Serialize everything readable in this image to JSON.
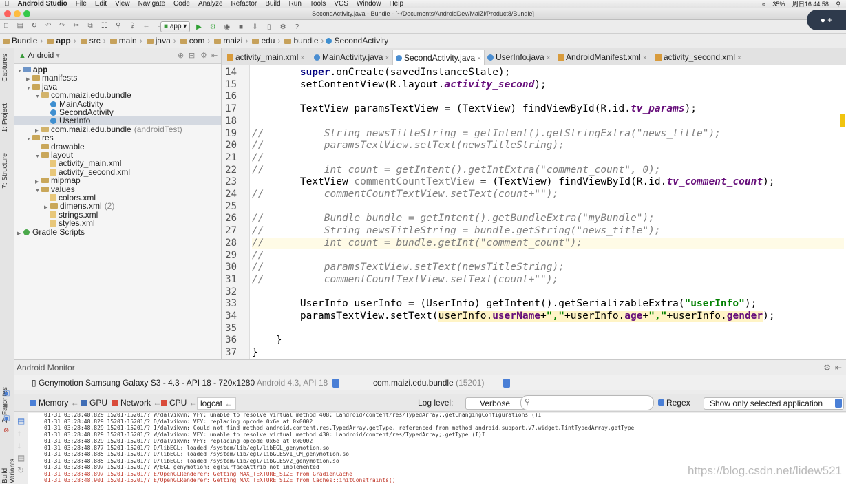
{
  "menubar": {
    "app": "Android Studio",
    "items": [
      "File",
      "Edit",
      "View",
      "Navigate",
      "Code",
      "Analyze",
      "Refactor",
      "Build",
      "Run",
      "Tools",
      "VCS",
      "Window",
      "Help"
    ],
    "battery": "35%",
    "clock": "周日16:44:58"
  },
  "window": {
    "title": "SecondActivity.java - Bundle - [~/Documents/AndroidDev/MaiZi/Product8/Bundle]"
  },
  "toolbar": {
    "run_config": "app"
  },
  "breadcrumb": [
    "Bundle",
    "app",
    "src",
    "main",
    "java",
    "com",
    "maizi",
    "edu",
    "bundle",
    "SecondActivity"
  ],
  "side_tabs": {
    "captures": "Captures",
    "project": "1: Project",
    "structure": "7: Structure",
    "favorites": "2: Favorites",
    "variants": "Build Variants"
  },
  "project": {
    "view": "Android",
    "tree": [
      {
        "label": "app",
        "indent": 0,
        "icon": "folder-blue",
        "open": true,
        "bold": true
      },
      {
        "label": "manifests",
        "indent": 1,
        "icon": "folder",
        "open": false
      },
      {
        "label": "java",
        "indent": 1,
        "icon": "folder",
        "open": true
      },
      {
        "label": "com.maizi.edu.bundle",
        "indent": 2,
        "icon": "package",
        "open": true
      },
      {
        "label": "MainActivity",
        "indent": 3,
        "icon": "class"
      },
      {
        "label": "SecondActivity",
        "indent": 3,
        "icon": "class"
      },
      {
        "label": "UserInfo",
        "indent": 3,
        "icon": "class",
        "selected": true
      },
      {
        "label": "com.maizi.edu.bundle",
        "suffix": "(androidTest)",
        "indent": 2,
        "icon": "package",
        "open": false
      },
      {
        "label": "res",
        "indent": 1,
        "icon": "folder",
        "open": true
      },
      {
        "label": "drawable",
        "indent": 2,
        "icon": "folder"
      },
      {
        "label": "layout",
        "indent": 2,
        "icon": "folder",
        "open": true
      },
      {
        "label": "activity_main.xml",
        "indent": 3,
        "icon": "xml"
      },
      {
        "label": "activity_second.xml",
        "indent": 3,
        "icon": "xml"
      },
      {
        "label": "mipmap",
        "indent": 2,
        "icon": "folder",
        "open": false
      },
      {
        "label": "values",
        "indent": 2,
        "icon": "folder",
        "open": true
      },
      {
        "label": "colors.xml",
        "indent": 3,
        "icon": "xml"
      },
      {
        "label": "dimens.xml",
        "suffix": "(2)",
        "indent": 3,
        "icon": "folder",
        "open": false
      },
      {
        "label": "strings.xml",
        "indent": 3,
        "icon": "xml"
      },
      {
        "label": "styles.xml",
        "indent": 3,
        "icon": "xml"
      },
      {
        "label": "Gradle Scripts",
        "indent": 0,
        "icon": "gradle",
        "open": false
      }
    ]
  },
  "tabs": [
    {
      "label": "activity_main.xml",
      "type": "xml",
      "active": false
    },
    {
      "label": "MainActivity.java",
      "type": "java",
      "active": false
    },
    {
      "label": "SecondActivity.java",
      "type": "java",
      "active": true
    },
    {
      "label": "UserInfo.java",
      "type": "java",
      "active": false
    },
    {
      "label": "AndroidManifest.xml",
      "type": "xml",
      "active": false
    },
    {
      "label": "activity_second.xml",
      "type": "xml",
      "active": false
    }
  ],
  "code": [
    {
      "n": "14",
      "html": "        <span class=\"kw\">super</span>.onCreate(savedInstanceState);"
    },
    {
      "n": "15",
      "html": "        setContentView(R.layout.<span class=\"fld\">activity_second</span>);"
    },
    {
      "n": "16",
      "html": ""
    },
    {
      "n": "17",
      "html": "        TextView paramsTextView = (TextView) findViewById(R.id.<span class=\"fld\">tv_params</span>);"
    },
    {
      "n": "18",
      "html": ""
    },
    {
      "n": "19",
      "html": "<span class=\"cmt\">//          String newsTitleString = getIntent().getStringExtra(\"news_title\");</span>"
    },
    {
      "n": "20",
      "html": "<span class=\"cmt\">//          paramsTextView.setText(newsTitleString);</span>"
    },
    {
      "n": "21",
      "html": "<span class=\"cmt\">//</span>"
    },
    {
      "n": "22",
      "html": "<span class=\"cmt\">//          int count = getIntent().getIntExtra(\"comment_count\", 0);</span>"
    },
    {
      "n": "23",
      "html": "        TextView <span class=\"cmt\" style=\"font-style:normal\">commentCountTextView</span> = (TextView) findViewById(R.id.<span class=\"fld\">tv_comment_count</span>);"
    },
    {
      "n": "24",
      "html": "<span class=\"cmt\">//          commentCountTextView.setText(count+\"\");</span>"
    },
    {
      "n": "25",
      "html": ""
    },
    {
      "n": "26",
      "html": "<span class=\"cmt\">//          Bundle bundle = getIntent().getBundleExtra(\"myBundle\");</span>"
    },
    {
      "n": "27",
      "html": "<span class=\"cmt\">//          String newsTitleString = bundle.getString(\"news_title\");</span>"
    },
    {
      "n": "28",
      "html": "<span class=\"cmt\">//          int count = bundle.getInt(\"comment_count\");</span>"
    },
    {
      "n": "29",
      "html": "<span class=\"cmt\">//</span>"
    },
    {
      "n": "30",
      "html": "<span class=\"cmt\">//          paramsTextView.setText(newsTitleString);</span>"
    },
    {
      "n": "31",
      "html": "<span class=\"cmt\">//          commentCountTextView.setText(count+\"\");</span>"
    },
    {
      "n": "32",
      "html": ""
    },
    {
      "n": "33",
      "html": "        UserInfo userInfo = (UserInfo) getIntent().getSerializableExtra(<span class=\"str\">\"userInfo\"</span>);"
    },
    {
      "n": "34",
      "html": "        paramsTextView.setText(<span class=\"hl\">userInfo.<span class=\"fld\" style=\"font-style:normal\">userName</span>+<span class=\"str\">\",\"</span>+userInfo.<span class=\"fld\" style=\"font-style:normal\">age</span>+<span class=\"str\">\",\"</span>+userInfo.<span class=\"fld\" style=\"font-style:normal\">gender</span></span>);"
    },
    {
      "n": "35",
      "html": ""
    },
    {
      "n": "36",
      "html": "    }"
    },
    {
      "n": "37",
      "html": "}"
    }
  ],
  "monitor": {
    "title": "Android Monitor",
    "device": "Genymotion Samsung Galaxy S3 - 4.3 - API 18 - 720x1280",
    "device_meta": "Android 4.3, API 18",
    "process": "com.maizi.edu.bundle",
    "process_pid": "(15201)",
    "tabs": [
      "Memory",
      "GPU",
      "Network",
      "CPU",
      "logcat"
    ],
    "log_level_label": "Log level:",
    "log_level": "Verbose",
    "search_placeholder": "",
    "regex_label": "Regex",
    "filter": "Show only selected application",
    "log": [
      "01-31 03:28:48.829 15201-15201/? W/dalvikvm: VFY: unable to resolve virtual method 408: Landroid/content/res/TypedArray;.getChangingConfigurations ()I",
      "01-31 03:28:48.829 15201-15201/? D/dalvikvm: VFY: replacing opcode 0x6e at 0x0002",
      "01-31 03:28:48.829 15201-15201/? I/dalvikvm: Could not find method android.content.res.TypedArray.getType, referenced from method android.support.v7.widget.TintTypedArray.getType",
      "01-31 03:28:48.829 15201-15201/? W/dalvikvm: VFY: unable to resolve virtual method 430: Landroid/content/res/TypedArray;.getType (I)I",
      "01-31 03:28:48.829 15201-15201/? D/dalvikvm: VFY: replacing opcode 0x6e at 0x0002",
      "01-31 03:28:48.877 15201-15201/? D/libEGL: loaded /system/lib/egl/libEGL_genymotion.so",
      "01-31 03:28:48.885 15201-15201/? D/libEGL: loaded /system/lib/egl/libGLESv1_CM_genymotion.so",
      "01-31 03:28:48.885 15201-15201/? D/libEGL: loaded /system/lib/egl/libGLESv2_genymotion.so",
      "01-31 03:28:48.897 15201-15201/? W/EGL_genymotion: eglSurfaceAttrib not implemented",
      "01-31 03:28:48.897 15201-15201/? E/OpenGLRenderer: Getting MAX_TEXTURE_SIZE from GradienCache",
      "01-31 03:28:48.901 15201-15201/? E/OpenGLRenderer: Getting MAX_TEXTURE_SIZE from Caches::initConstraints()"
    ]
  },
  "watermark": "https://blog.csdn.net/lidew521"
}
